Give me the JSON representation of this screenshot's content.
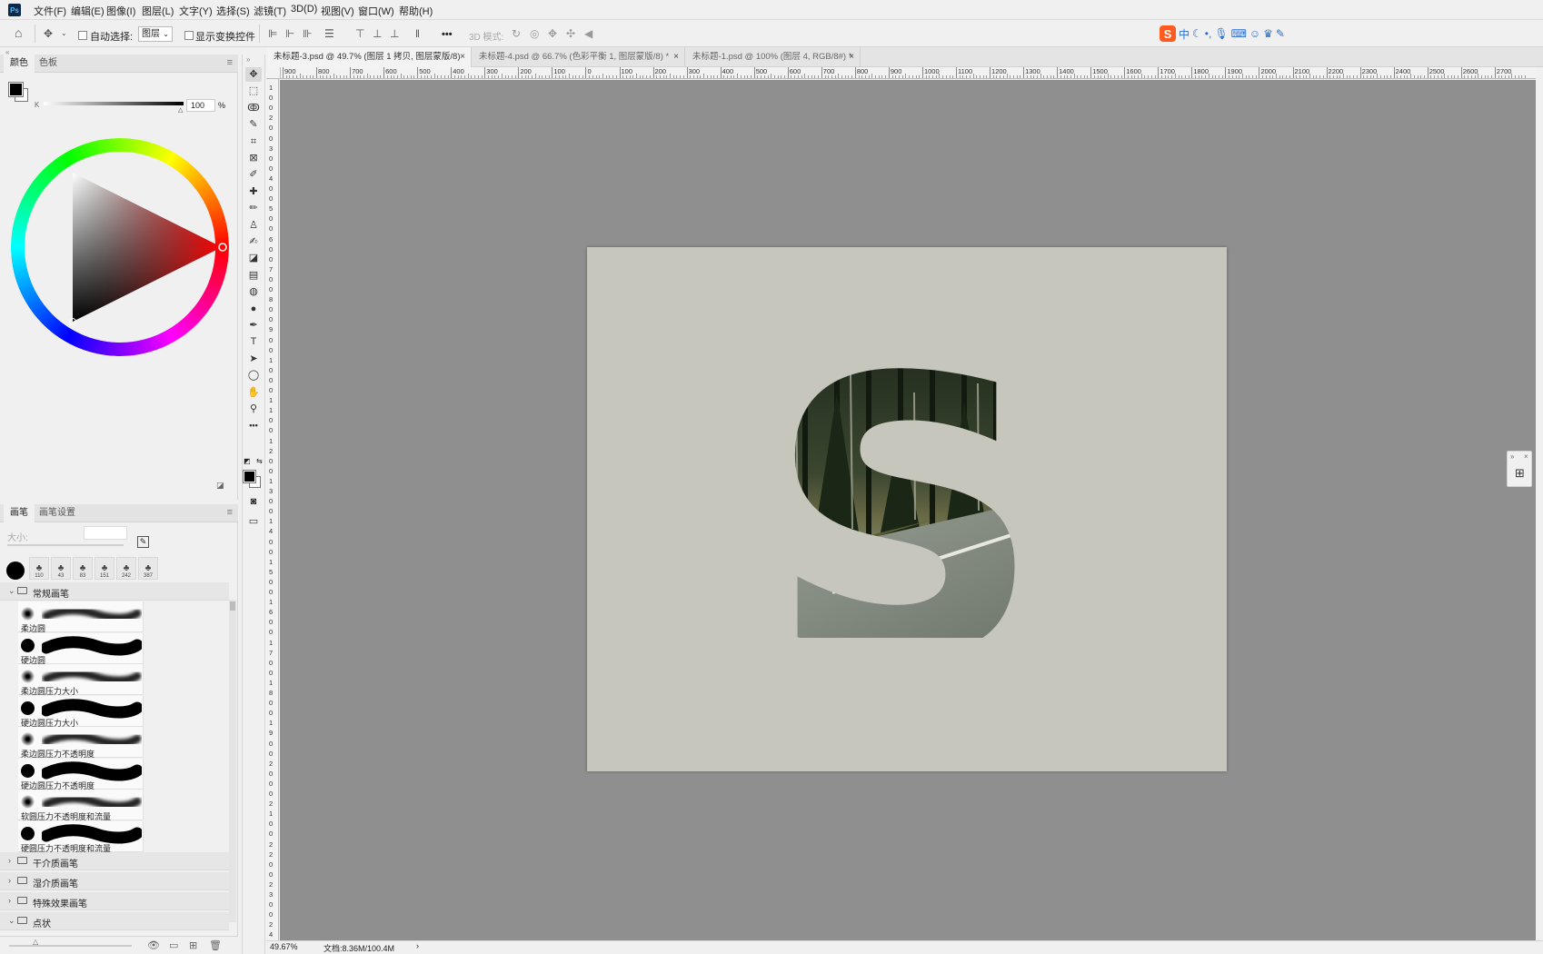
{
  "app": {
    "logo_text": "Ps"
  },
  "menu": [
    {
      "label": "文件(F)"
    },
    {
      "label": "编辑(E)"
    },
    {
      "label": "图像(I)"
    },
    {
      "label": "图层(L)"
    },
    {
      "label": "文字(Y)"
    },
    {
      "label": "选择(S)"
    },
    {
      "label": "滤镜(T)"
    },
    {
      "label": "3D(D)"
    },
    {
      "label": "视图(V)"
    },
    {
      "label": "窗口(W)"
    },
    {
      "label": "帮助(H)"
    }
  ],
  "options_bar": {
    "auto_select_label": "自动选择:",
    "auto_select_checked": false,
    "layer_mode_value": "图层",
    "show_transform_label": "显示变换控件",
    "show_transform_checked": false,
    "mode_3d_label": "3D 模式:",
    "more_label": "•••"
  },
  "ime_toolbar": {
    "logo": "S",
    "lang": "中"
  },
  "color_panel": {
    "tabs": [
      "颜色",
      "色板"
    ],
    "active_tab": 0,
    "foreground_color": "#000000",
    "background_color": "#ffffff",
    "slider_channel_label": "K",
    "slider_value": "100",
    "slider_unit": "%",
    "hue_marker_color": "#ff0000"
  },
  "brush_panel": {
    "tabs": [
      "画笔",
      "画笔设置"
    ],
    "active_tab": 0,
    "size_label": "大小:",
    "recent_brushes": [
      {
        "size": ""
      },
      {
        "size": "110"
      },
      {
        "size": "43"
      },
      {
        "size": "83"
      },
      {
        "size": "151"
      },
      {
        "size": "242"
      },
      {
        "size": "387"
      }
    ],
    "groups": [
      {
        "name": "常规画笔",
        "expanded": true,
        "items": [
          {
            "name": "柔边圆",
            "soft": true
          },
          {
            "name": "硬边圆",
            "soft": false
          },
          {
            "name": "柔边圆压力大小",
            "soft": true
          },
          {
            "name": "硬边圆压力大小",
            "soft": false
          },
          {
            "name": "柔边圆压力不透明度",
            "soft": true
          },
          {
            "name": "硬边圆压力不透明度",
            "soft": false
          },
          {
            "name": "软圆压力不透明度和流量",
            "soft": true
          },
          {
            "name": "硬圆压力不透明度和流量",
            "soft": false
          }
        ]
      },
      {
        "name": "干介质画笔",
        "expanded": false
      },
      {
        "name": "湿介质画笔",
        "expanded": false
      },
      {
        "name": "特殊效果画笔",
        "expanded": false
      },
      {
        "name": "点状",
        "expanded": true
      }
    ]
  },
  "tools": [
    {
      "name": "move",
      "glyph": "✥",
      "active": true
    },
    {
      "name": "marquee",
      "glyph": "⬚"
    },
    {
      "name": "lasso",
      "glyph": "ↂ"
    },
    {
      "name": "quick-select",
      "glyph": "✎"
    },
    {
      "name": "crop",
      "glyph": "⌗"
    },
    {
      "name": "frame",
      "glyph": "⊠"
    },
    {
      "name": "eyedropper",
      "glyph": "✐"
    },
    {
      "name": "healing",
      "glyph": "✚"
    },
    {
      "name": "brush",
      "glyph": "✏"
    },
    {
      "name": "stamp",
      "glyph": "♙"
    },
    {
      "name": "history-brush",
      "glyph": "✍"
    },
    {
      "name": "eraser",
      "glyph": "◪"
    },
    {
      "name": "gradient",
      "glyph": "▤"
    },
    {
      "name": "blur",
      "glyph": "◍"
    },
    {
      "name": "dodge",
      "glyph": "●"
    },
    {
      "name": "pen",
      "glyph": "✒"
    },
    {
      "name": "type",
      "glyph": "T"
    },
    {
      "name": "path-select",
      "glyph": "➤"
    },
    {
      "name": "ellipse",
      "glyph": "◯"
    },
    {
      "name": "hand",
      "glyph": "✋"
    },
    {
      "name": "zoom",
      "glyph": "⚲"
    },
    {
      "name": "more-tools",
      "glyph": "•••"
    }
  ],
  "documents": {
    "tabs": [
      {
        "label": "未标题-3.psd @ 49.7% (图层 1 拷贝, 图层蒙版/8)",
        "active": true
      },
      {
        "label": "未标题-4.psd @ 66.7% (色彩平衡 1, 图层蒙版/8) *",
        "active": false
      },
      {
        "label": "未标题-1.psd @ 100% (图层 4, RGB/8#) *",
        "active": false
      }
    ],
    "close_glyph": "×"
  },
  "rulers": {
    "top_labels": [
      "900",
      "800",
      "700",
      "600",
      "500",
      "400",
      "300",
      "200",
      "100",
      "0",
      "100",
      "200",
      "300",
      "400",
      "500",
      "600",
      "700",
      "800",
      "900",
      "1000",
      "1100",
      "1200",
      "1300",
      "1400",
      "1500",
      "1600",
      "1700",
      "1800",
      "1900",
      "2000",
      "2100",
      "2200",
      "2300",
      "2400",
      "2500",
      "2600",
      "2700"
    ],
    "left_labels": [
      "1",
      "0",
      "0",
      "2",
      "0",
      "0",
      "3",
      "0",
      "0",
      "4",
      "0",
      "0",
      "5",
      "0",
      "0",
      "6",
      "0",
      "0",
      "7",
      "0",
      "0",
      "8",
      "0",
      "0",
      "9",
      "0",
      "0",
      "1",
      "0",
      "0",
      "0",
      "1",
      "1",
      "0",
      "0",
      "1",
      "2",
      "0",
      "0",
      "1",
      "3",
      "0",
      "0",
      "1",
      "4",
      "0",
      "0",
      "1",
      "5",
      "0",
      "0",
      "1",
      "6",
      "0",
      "0",
      "1",
      "7",
      "0",
      "0",
      "1",
      "8",
      "0",
      "0",
      "1",
      "9",
      "0",
      "0",
      "2",
      "0",
      "0",
      "0",
      "2",
      "1",
      "0",
      "0",
      "2",
      "2",
      "0",
      "0",
      "2",
      "3",
      "0",
      "0",
      "2",
      "4",
      "0",
      "0"
    ]
  },
  "canvas": {
    "pasteboard_color": "#8f8f8f",
    "document_color": "#c6c6bc",
    "letter": "S"
  },
  "status": {
    "zoom": "49.67%",
    "doc_info": "文档:8.36M/100.4M",
    "arrow": "›"
  }
}
